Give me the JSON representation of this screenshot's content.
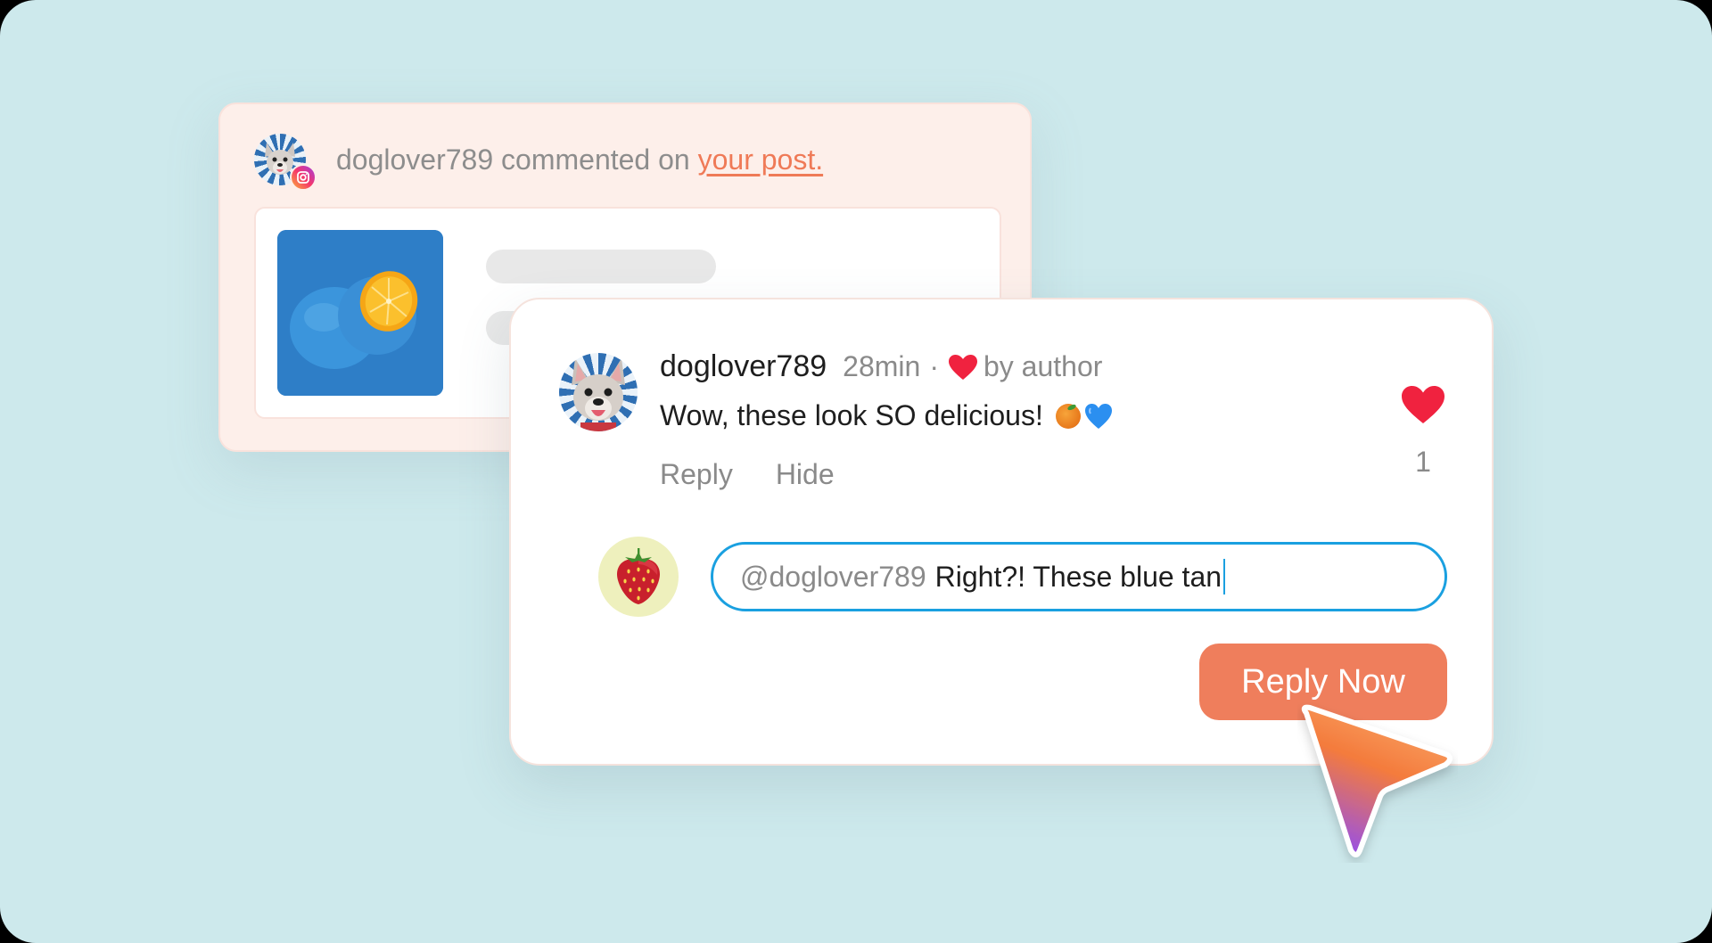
{
  "notification": {
    "username": "doglover789",
    "action_text": "commented on",
    "link_text": "your post.",
    "platform_icon": "instagram-icon",
    "post_image": "blue-orange-photo"
  },
  "comment": {
    "username": "doglover789",
    "time": "28min",
    "separator": "·",
    "liked_by": "by author",
    "text": "Wow, these look SO delicious!",
    "emojis": [
      "tangerine-emoji",
      "blue-heart-emoji"
    ],
    "actions": {
      "reply": "Reply",
      "hide": "Hide"
    },
    "like_count": "1"
  },
  "reply": {
    "avatar": "strawberry-icon",
    "mention": "@doglover789",
    "typed_text": "Right?! These blue tan",
    "button_label": "Reply Now"
  },
  "colors": {
    "background": "#cde9ec",
    "accent": "#ef7e5c",
    "link": "#ef7a57",
    "input_border": "#1aa0e0",
    "heart": "#f0223f"
  }
}
